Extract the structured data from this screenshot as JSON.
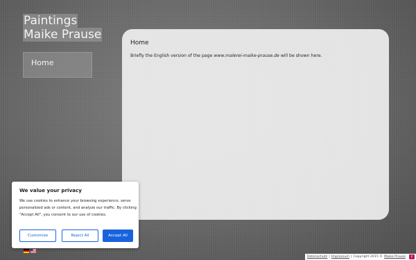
{
  "site": {
    "title_line1": "Paintings",
    "title_line2": "Maike Prause"
  },
  "nav": {
    "items": [
      {
        "label": "Home"
      }
    ]
  },
  "content": {
    "title": "Home",
    "text_before": "Briefly the English version of the page ",
    "text_link": "www.malerei-maike-prause.de",
    "text_after": " will be shown here."
  },
  "cookie": {
    "title": "We value your privacy",
    "text": "We use cookies to enhance your browsing experience, serve personalized ads or content, and analyze our traffic. By clicking \"Accept All\", you consent to our use of cookies.",
    "customize_label": "Customize",
    "reject_label": "Reject All",
    "accept_label": "Accept All",
    "accent_color": "#1863dc"
  },
  "languages": [
    {
      "icon": "german-flag-icon"
    },
    {
      "icon": "us-flag-icon"
    }
  ],
  "footer": {
    "datenschutz": "Datenschutz",
    "sep1": "|",
    "impressum": "Impressum",
    "sep2": "|",
    "copyright": "Copyright 2015 ©",
    "author": "Maike Prause",
    "icon": "fb-icon",
    "icon_glyph": "f",
    "icon_color": "#c2185b"
  }
}
